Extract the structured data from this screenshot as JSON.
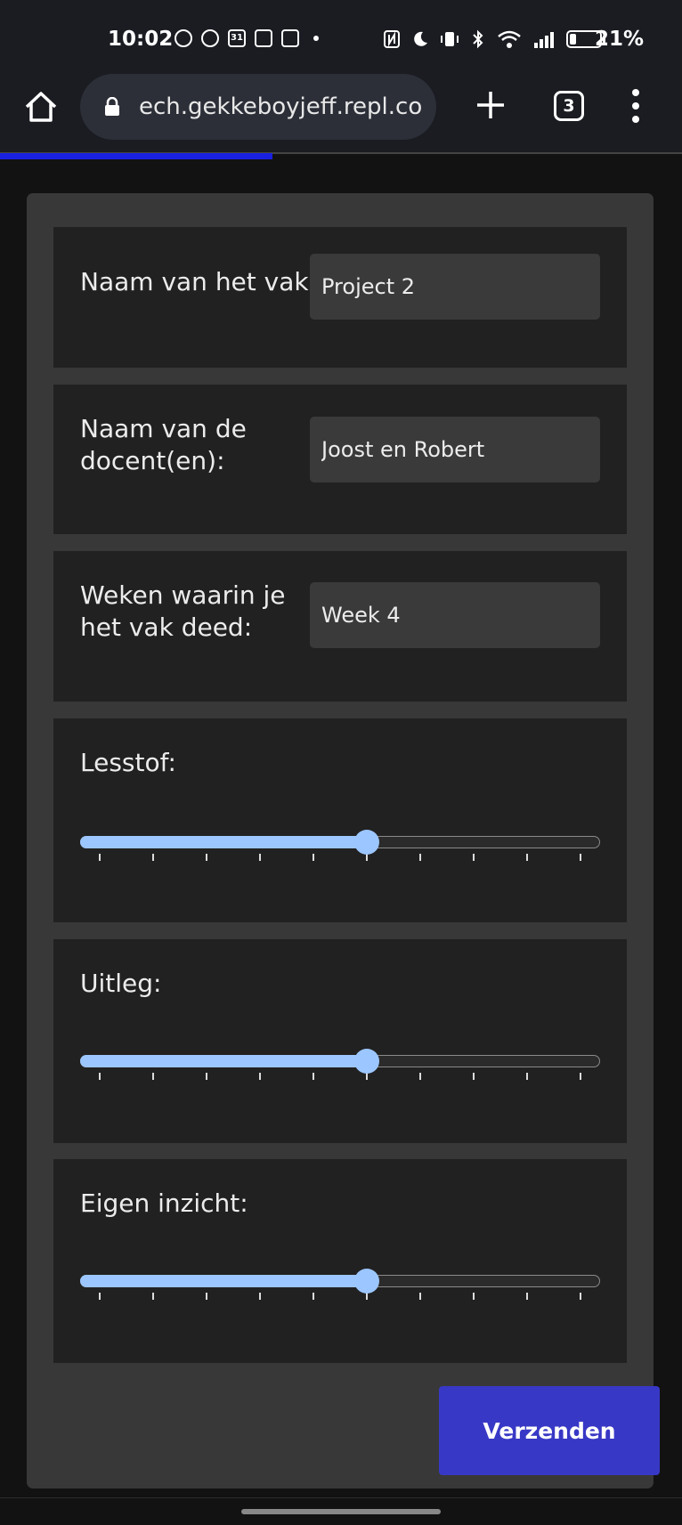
{
  "status_bar": {
    "time": "10:02",
    "calendar_day": "31",
    "battery_percent": "21%",
    "battery_level": 0.21,
    "left_icons": [
      "whatsapp-icon",
      "snapchat-icon",
      "calendar-icon",
      "fm-icon",
      "teams-icon",
      "dot-icon"
    ],
    "right_icons": [
      "nfc-icon",
      "moon-icon",
      "vibrate-icon",
      "bluetooth-icon",
      "wifi-icon",
      "signal-icon",
      "battery-icon"
    ]
  },
  "browser": {
    "url": "ech.gekkeboyjeff.repl.co",
    "tab_count": "3",
    "page_load_progress": 0.4
  },
  "form": {
    "subject_label": "Naam van het vak:",
    "subject_value": "Project 2",
    "teacher_label": "Naam van de docent(en):",
    "teacher_value": "Joost en Robert",
    "weeks_label": "Weken waarin je het vak deed:",
    "weeks_value": "Week 4",
    "sliders": [
      {
        "label": "Lesstof:",
        "value": 6,
        "min": 1,
        "max": 10
      },
      {
        "label": "Uitleg:",
        "value": 6,
        "min": 1,
        "max": 10
      },
      {
        "label": "Eigen inzicht:",
        "value": 6,
        "min": 1,
        "max": 10
      }
    ],
    "submit_label": "Verzenden"
  },
  "colors": {
    "accent_button": "#3838c6",
    "slider_accent": "#9cc6ff",
    "progress_bar": "#1a20e0"
  }
}
